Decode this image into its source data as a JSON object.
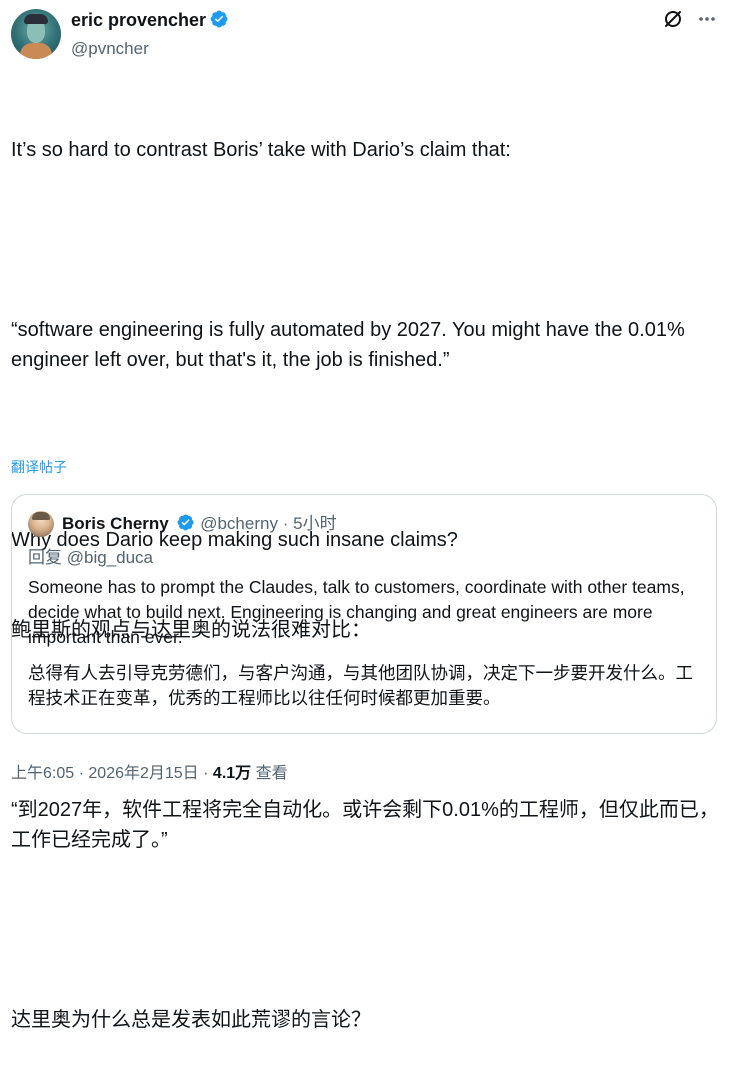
{
  "author": {
    "name": "eric provencher",
    "handle": "@pvncher"
  },
  "tweet": {
    "en_p1": "It’s so hard to contrast Boris’ take with Dario’s claim that:",
    "en_p2": "“software engineering is fully automated by 2027. You might have the 0.01% engineer left over, but that's it, the job is finished.”",
    "en_p3": "Why does Dario keep making such insane claims?",
    "cn_p1": "鲍里斯的观点与达里奥的说法很难对比：",
    "cn_p2": "“到2027年，软件工程将完全自动化。或许会剩下0.01%的工程师，但仅此而已，工作已经完成了。”",
    "cn_p3": "达里奥为什么总是发表如此荒谬的言论？"
  },
  "translate_label": "翻译帖子",
  "quote": {
    "name": "Boris Cherny",
    "handle": "@bcherny",
    "separator": "·",
    "time": "5小时",
    "reply_prefix": "回复",
    "reply_handle": "@big_duca",
    "en": "Someone has to prompt the Claudes, talk to customers, coordinate with other teams, decide what to build next. Engineering is changing and great engineers are more important than ever.",
    "cn": "总得有人去引导克劳德们，与客户沟通，与其他团队协调，决定下一步要开发什么。工程技术正在变革，优秀的工程师比以往任何时候都更加重要。"
  },
  "footer": {
    "time": "上午6:05",
    "dot1": "·",
    "date": "2026年2月15日",
    "dot2": "·",
    "views": "4.1万",
    "views_label": "查看"
  },
  "colors": {
    "accent": "#1d9bf0",
    "secondary_text": "#536471",
    "border": "#cfd9de"
  },
  "icons": [
    "verified-badge-icon",
    "grok-icon",
    "more-icon"
  ]
}
